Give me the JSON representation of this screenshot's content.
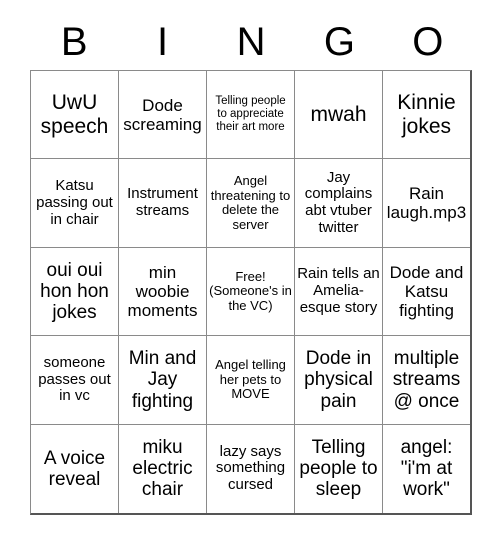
{
  "card": {
    "title": "BINGO",
    "header_letters": [
      "B",
      "I",
      "N",
      "G",
      "O"
    ],
    "rows": [
      {
        "cells": [
          {
            "text": "UwU speech",
            "size": "fs-xl",
            "free": false
          },
          {
            "text": "Dode screaming",
            "size": "fs-md",
            "free": false
          },
          {
            "text": "Telling people to appreciate their art more",
            "size": "fs-xxs",
            "free": false
          },
          {
            "text": "mwah",
            "size": "fs-xl",
            "free": false
          },
          {
            "text": "Kinnie jokes",
            "size": "fs-xl",
            "free": false
          }
        ]
      },
      {
        "cells": [
          {
            "text": "Katsu passing out in chair",
            "size": "fs-sm",
            "free": false
          },
          {
            "text": "Instrument streams",
            "size": "fs-sm",
            "free": false
          },
          {
            "text": "Angel threatening to delete the server",
            "size": "fs-xs",
            "free": false
          },
          {
            "text": "Jay complains abt vtuber twitter",
            "size": "fs-sm",
            "free": false
          },
          {
            "text": "Rain laugh.mp3",
            "size": "fs-md",
            "free": false
          }
        ]
      },
      {
        "cells": [
          {
            "text": "oui oui hon hon jokes",
            "size": "fs-lg",
            "free": false
          },
          {
            "text": "min woobie moments",
            "size": "fs-md",
            "free": false
          },
          {
            "text": "Free! (Someone's in the VC)",
            "size": "fs-xs",
            "free": true
          },
          {
            "text": "Rain tells an Amelia-esque story",
            "size": "fs-sm",
            "free": false
          },
          {
            "text": "Dode and Katsu fighting",
            "size": "fs-md",
            "free": false
          }
        ]
      },
      {
        "cells": [
          {
            "text": "someone passes out in vc",
            "size": "fs-sm",
            "free": false
          },
          {
            "text": "Min and Jay fighting",
            "size": "fs-lg",
            "free": false
          },
          {
            "text": "Angel telling her pets to MOVE",
            "size": "fs-xs",
            "free": false
          },
          {
            "text": "Dode in physical pain",
            "size": "fs-lg",
            "free": false
          },
          {
            "text": "multiple streams @ once",
            "size": "fs-lg",
            "free": false
          }
        ]
      },
      {
        "cells": [
          {
            "text": "A voice reveal",
            "size": "fs-lg",
            "free": false
          },
          {
            "text": "miku electric chair",
            "size": "fs-lg",
            "free": false
          },
          {
            "text": "lazy says something cursed",
            "size": "fs-sm",
            "free": false
          },
          {
            "text": "Telling people to sleep",
            "size": "fs-lg",
            "free": false
          },
          {
            "text": "angel: \"i'm at work\"",
            "size": "fs-lg",
            "free": false
          }
        ]
      }
    ]
  }
}
